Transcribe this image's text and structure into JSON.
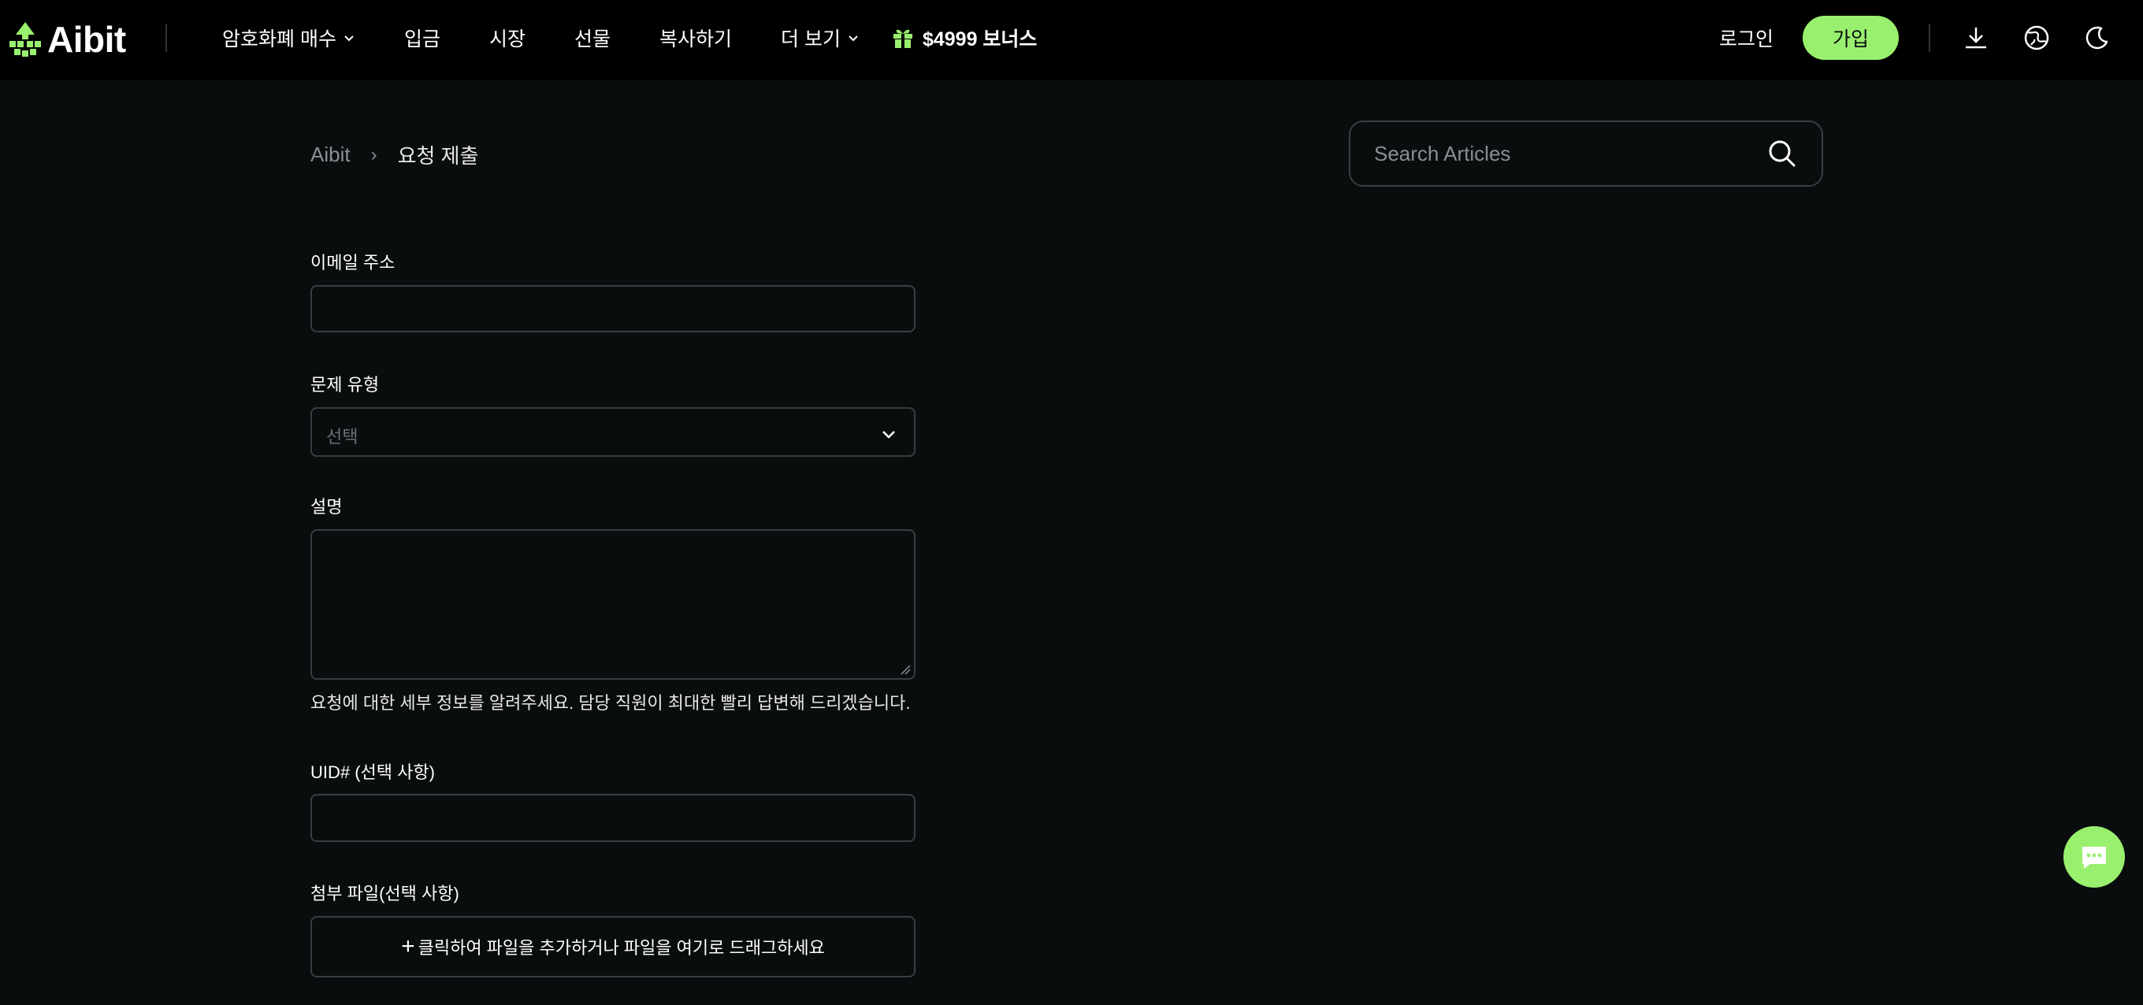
{
  "brand": {
    "name": "Aibit",
    "accent": "#99f06e"
  },
  "nav": {
    "items": [
      {
        "label": "암호화폐 매수",
        "dropdown": true
      },
      {
        "label": "입금",
        "dropdown": false
      },
      {
        "label": "시장",
        "dropdown": false
      },
      {
        "label": "선물",
        "dropdown": false
      },
      {
        "label": "복사하기",
        "dropdown": false
      },
      {
        "label": "더 보기",
        "dropdown": true
      }
    ],
    "bonus_label": "$4999 보너스",
    "login_label": "로그인",
    "signup_label": "가입",
    "icons": [
      "download-icon",
      "globe-icon",
      "moon-icon"
    ]
  },
  "breadcrumb": {
    "home": "Aibit",
    "separator": "›",
    "current": "요청 제출"
  },
  "search": {
    "placeholder": "Search Articles",
    "value": ""
  },
  "form": {
    "email_label": "이메일 주소",
    "email_value": "",
    "issue_type_label": "문제 유형",
    "issue_type_placeholder": "선택",
    "description_label": "설명",
    "description_value": "",
    "description_hint": "요청에 대한 세부 정보를 알려주세요. 담당 직원이 최대한 빨리 답변해 드리겠습니다.",
    "uid_label": "UID# (선택 사항)",
    "uid_value": "",
    "attachment_label": "첨부 파일(선택 사항)",
    "attachment_dropzone": "클릭하여 파일을 추가하거나 파일을 여기로 드래그하세요"
  },
  "chat": {
    "icon": "chat-icon"
  }
}
